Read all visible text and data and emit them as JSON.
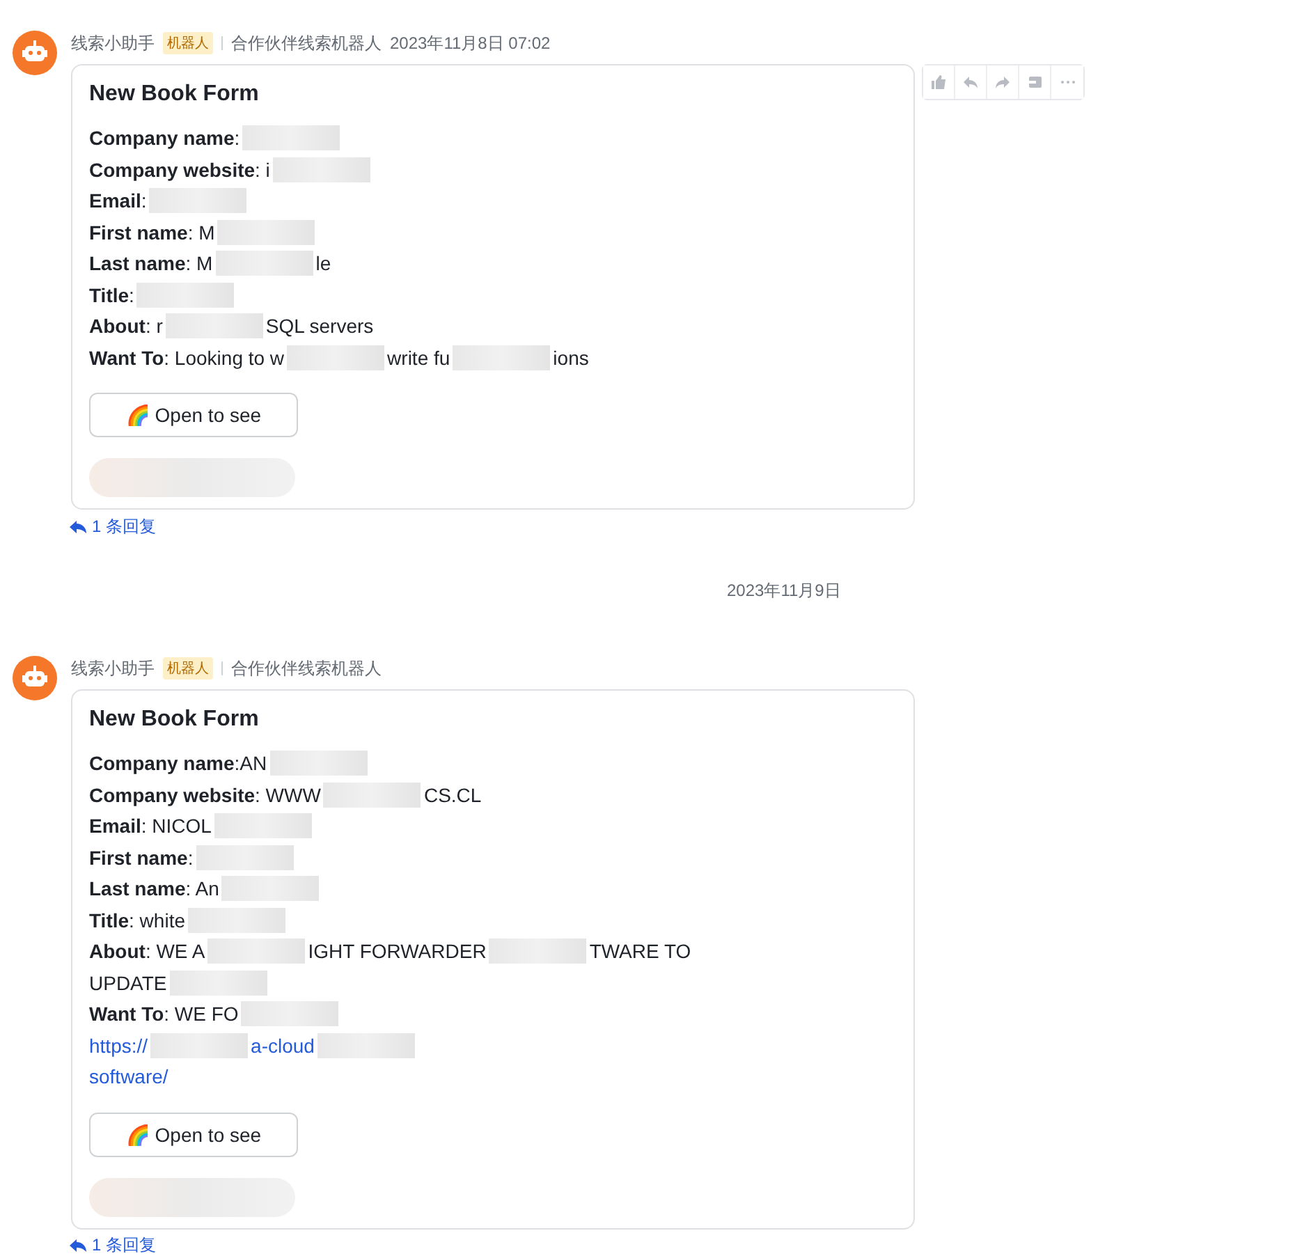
{
  "messages": [
    {
      "kind": "message",
      "sender": "线索小助手",
      "tag": "机器人",
      "source": "合作伙伴线索机器人",
      "time": "2023年11月8日 07:02",
      "hovered": true,
      "card": {
        "title": "New Book Form",
        "lines": [
          [
            {
              "kind": "text",
              "text": "**Company name**:"
            },
            {
              "kind": "blur"
            }
          ],
          [
            {
              "kind": "text",
              "text": "**Company website**: i"
            },
            {
              "kind": "blur"
            }
          ],
          [
            {
              "kind": "text",
              "text": "**Email**:"
            },
            {
              "kind": "blur"
            }
          ],
          [
            {
              "kind": "text",
              "text": "**First name**: M"
            },
            {
              "kind": "blur"
            }
          ],
          [
            {
              "kind": "text",
              "text": "**Last name**: M"
            },
            {
              "kind": "blur"
            },
            {
              "kind": "text",
              "text": "le"
            }
          ],
          [
            {
              "kind": "text",
              "text": "**Title**:"
            },
            {
              "kind": "blur"
            }
          ],
          [
            {
              "kind": "text",
              "text": "**About**: r"
            },
            {
              "kind": "blur"
            },
            {
              "kind": "text",
              "text": "SQL servers"
            }
          ],
          [
            {
              "kind": "text",
              "text": "**Want To**: Looking to w"
            },
            {
              "kind": "blur"
            },
            {
              "kind": "text",
              "text": "write fu"
            },
            {
              "kind": "blur"
            },
            {
              "kind": "text",
              "text": "ions"
            }
          ]
        ],
        "button": {
          "icon": "🌈",
          "label": "Open to see"
        }
      },
      "replies": "1 条回复"
    },
    {
      "kind": "divider",
      "text": "2023年11月9日"
    },
    {
      "kind": "message",
      "sender": "线索小助手",
      "tag": "机器人",
      "source": "合作伙伴线索机器人",
      "hovered": false,
      "card": {
        "title": "New Book Form",
        "lines": [
          [
            {
              "kind": "text",
              "text": "**Company name**:AN"
            },
            {
              "kind": "blur"
            }
          ],
          [
            {
              "kind": "text",
              "text": "**Company website**: WWW"
            },
            {
              "kind": "blur"
            },
            {
              "kind": "text",
              "text": "CS.CL"
            }
          ],
          [
            {
              "kind": "text",
              "text": "**Email**: NICOL"
            },
            {
              "kind": "blur"
            }
          ],
          [
            {
              "kind": "text",
              "text": "**First name**:"
            },
            {
              "kind": "blur"
            }
          ],
          [
            {
              "kind": "text",
              "text": "**Last name**: An"
            },
            {
              "kind": "blur"
            }
          ],
          [
            {
              "kind": "text",
              "text": "**Title**: white"
            },
            {
              "kind": "blur"
            }
          ],
          [
            {
              "kind": "text",
              "text": "**About**: WE A"
            },
            {
              "kind": "blur"
            },
            {
              "kind": "text",
              "text": "IGHT FORWARDER"
            },
            {
              "kind": "blur"
            },
            {
              "kind": "text",
              "text": "TWARE TO"
            }
          ],
          [
            {
              "kind": "text",
              "text": "UPDATE"
            },
            {
              "kind": "blur"
            }
          ],
          [
            {
              "kind": "text",
              "text": "**Want To**: WE FO"
            },
            {
              "kind": "blur"
            }
          ],
          [
            {
              "kind": "link",
              "text": "https://"
            },
            {
              "kind": "blur"
            },
            {
              "kind": "link",
              "text": "a-cloud"
            },
            {
              "kind": "blur"
            }
          ],
          [
            {
              "kind": "link",
              "text": "software/"
            }
          ]
        ],
        "button": {
          "icon": "🌈",
          "label": "Open to see"
        }
      },
      "replies": "1 条回复"
    }
  ]
}
